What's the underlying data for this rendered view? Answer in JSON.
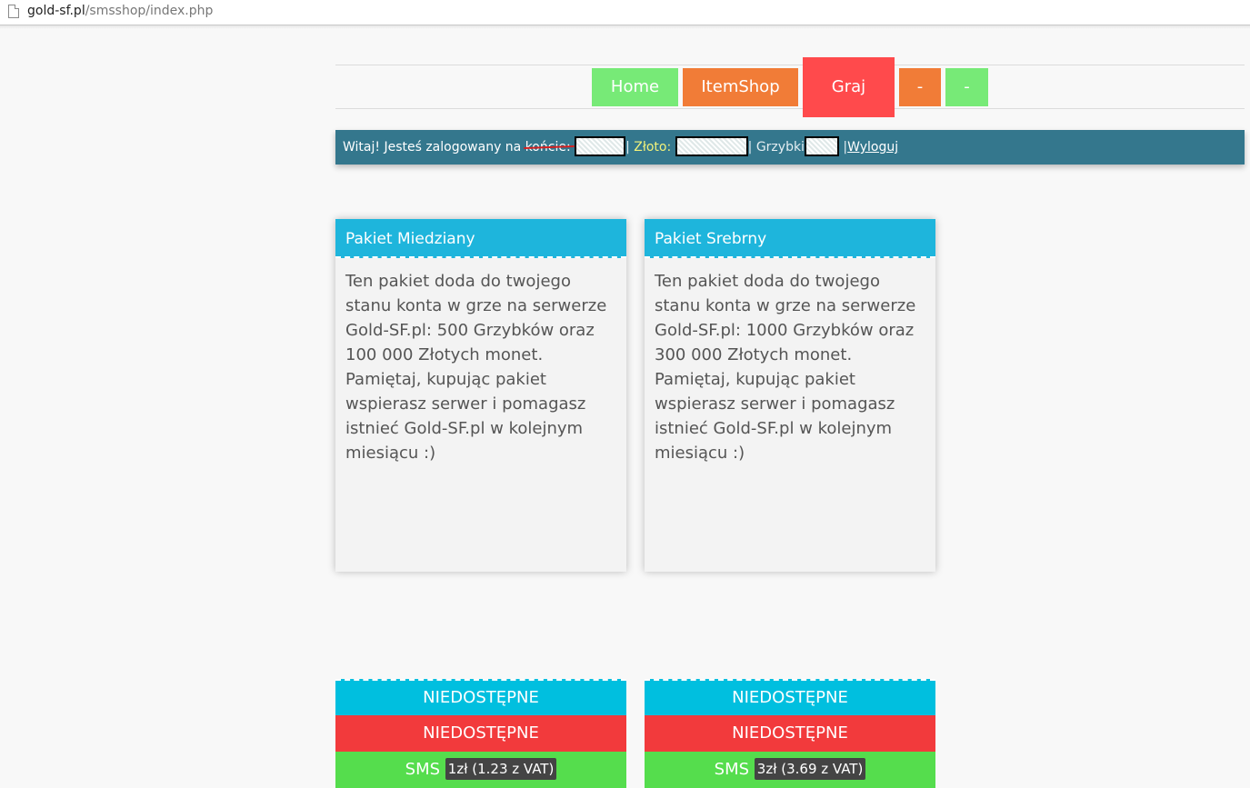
{
  "browser": {
    "url_host": "gold-sf.pl",
    "url_path": "/smsshop/index.php"
  },
  "nav": {
    "items": [
      {
        "label": "Home"
      },
      {
        "label": "ItemShop"
      },
      {
        "label": "Graj"
      },
      {
        "label": "-"
      },
      {
        "label": "-"
      }
    ]
  },
  "userbar": {
    "welcome": "Witaj! Jesteś zalogowany na ",
    "account_word": "końcie:",
    "sep": "|",
    "gold_label": " Złoto: ",
    "mushrooms_label": " Grzybki",
    "logout": "Wyloguj"
  },
  "cards": [
    {
      "title": "Pakiet Miedziany",
      "description": "Ten pakiet doda do twojego stanu konta w grze na serwerze Gold-SF.pl: 500 Grzybków oraz 100 000 Złotych monet. Pamiętaj, kupując pakiet wspierasz serwer i pomagasz istnieć Gold-SF.pl w kolejnym miesiącu :)",
      "option1": "NIEDOSTĘPNE",
      "option2": "NIEDOSTĘPNE",
      "sms_label": "SMS",
      "sms_price": "1zł (1.23 z VAT)"
    },
    {
      "title": "Pakiet Srebrny",
      "description": "Ten pakiet doda do twojego stanu konta w grze na serwerze Gold-SF.pl: 1000 Grzybków oraz 300 000 Złotych monet. Pamiętaj, kupując pakiet wspierasz serwer i pomagasz istnieć Gold-SF.pl w kolejnym miesiącu :)",
      "option1": "NIEDOSTĘPNE",
      "option2": "NIEDOSTĘPNE",
      "sms_label": "SMS",
      "sms_price": "3zł (3.69 z VAT)"
    }
  ],
  "colors": {
    "nav_green": "#77ea77",
    "nav_orange": "#f17c37",
    "nav_red": "#ff4a4c",
    "userbar": "#34778d",
    "card_head": "#1eb5dc",
    "row_cyan": "#00bfdf",
    "row_red": "#f23a3c",
    "row_green": "#55dd4d"
  }
}
